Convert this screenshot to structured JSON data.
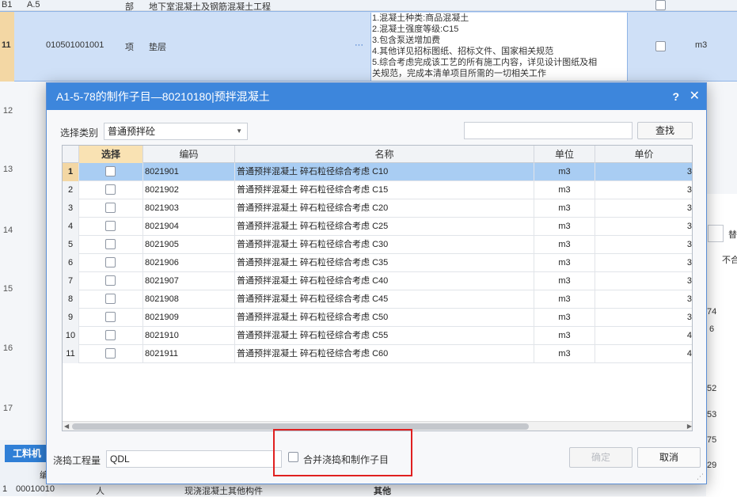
{
  "background": {
    "row_b1": {
      "num": "B1",
      "code": "A.5",
      "type": "部",
      "name": "地下室混凝土及钢筋混凝土工程"
    },
    "row_11": {
      "num": "11",
      "code": "010501001001",
      "type": "项",
      "name": "垫层",
      "more": "···",
      "features": [
        "1.混凝土种类:商品混凝土",
        "2.混凝土强度等级:C15",
        "3.包含泵送增加费",
        "4.其他详见招标图纸、招标文件、国家相关规范",
        "5.综合考虑完成该工艺的所有施工内容，详见设计图纸及相",
        "关规范，完成本清单项目所需的一切相关工作"
      ],
      "unit": "m3"
    },
    "row_numbers": [
      "12",
      "13",
      "14",
      "15",
      "16",
      "17"
    ],
    "right_panel": {
      "btn": "替",
      "header": "不合",
      "val1": "74",
      "val2": "6",
      "val3": "52",
      "val4": "53",
      "val5": "75",
      "val6": "29"
    },
    "bottom": {
      "tab": "工料机",
      "col": "编",
      "row_num": "1",
      "row_code": "00010010",
      "row_type": "人",
      "tree_item": "现浇混凝土其他构件",
      "other_label": "其他"
    }
  },
  "dialog": {
    "title": "A1-5-78的制作子目—80210180|预拌混凝土",
    "help": "?",
    "close": "✕",
    "category_label": "选择类别",
    "category_value": "普通预拌砼",
    "search_value": "",
    "search_button": "查找",
    "columns": [
      "选择",
      "编码",
      "名称",
      "单位",
      "单价"
    ],
    "rows": [
      {
        "num": "1",
        "code": "8021901",
        "name": "普通预拌混凝土 碎石粒径综合考虑 C10",
        "unit": "m3",
        "price": "3",
        "selected": true
      },
      {
        "num": "2",
        "code": "8021902",
        "name": "普通预拌混凝土 碎石粒径综合考虑 C15",
        "unit": "m3",
        "price": "3"
      },
      {
        "num": "3",
        "code": "8021903",
        "name": "普通预拌混凝土 碎石粒径综合考虑 C20",
        "unit": "m3",
        "price": "3"
      },
      {
        "num": "4",
        "code": "8021904",
        "name": "普通预拌混凝土 碎石粒径综合考虑 C25",
        "unit": "m3",
        "price": "3"
      },
      {
        "num": "5",
        "code": "8021905",
        "name": "普通预拌混凝土 碎石粒径综合考虑 C30",
        "unit": "m3",
        "price": "3"
      },
      {
        "num": "6",
        "code": "8021906",
        "name": "普通预拌混凝土 碎石粒径综合考虑 C35",
        "unit": "m3",
        "price": "3"
      },
      {
        "num": "7",
        "code": "8021907",
        "name": "普通预拌混凝土 碎石粒径综合考虑 C40",
        "unit": "m3",
        "price": "3"
      },
      {
        "num": "8",
        "code": "8021908",
        "name": "普通预拌混凝土 碎石粒径综合考虑 C45",
        "unit": "m3",
        "price": "3"
      },
      {
        "num": "9",
        "code": "8021909",
        "name": "普通预拌混凝土 碎石粒径综合考虑 C50",
        "unit": "m3",
        "price": "3"
      },
      {
        "num": "10",
        "code": "8021910",
        "name": "普通预拌混凝土 碎石粒径综合考虑 C55",
        "unit": "m3",
        "price": "4"
      },
      {
        "num": "11",
        "code": "8021911",
        "name": "普通预拌混凝土 碎石粒径综合考虑 C60",
        "unit": "m3",
        "price": "4"
      }
    ],
    "pour_label": "浇捣工程量",
    "pour_value": "QDL",
    "merge_label": "合并浇捣和制作子目",
    "merge_checked": false,
    "confirm": "确定",
    "cancel": "取消"
  },
  "colors": {
    "title_bar": "#3d86dc",
    "selected_row": "#a9cdf3",
    "highlight": "#e02020"
  }
}
